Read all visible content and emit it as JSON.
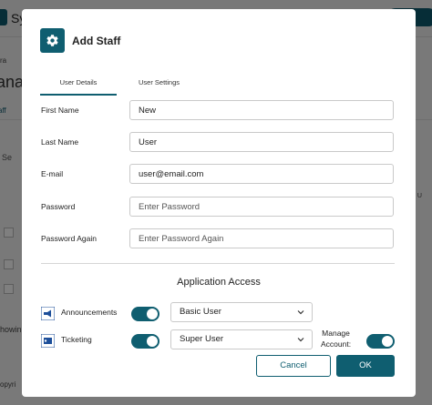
{
  "background": {
    "app_title": "Sy",
    "breadcrumb": "ra",
    "heading": "ana",
    "tab": "aff",
    "search": "Se",
    "column": "d U",
    "showing": "howin",
    "copyright": "opyri"
  },
  "modal": {
    "title": "Add Staff",
    "tabs": [
      {
        "label": "User Details",
        "active": true
      },
      {
        "label": "User Settings",
        "active": false
      }
    ],
    "fields": {
      "first_name": {
        "label": "First Name",
        "value": "New"
      },
      "last_name": {
        "label": "Last Name",
        "value": "User"
      },
      "email": {
        "label": "E-mail",
        "value": "user@email.com"
      },
      "password": {
        "label": "Password",
        "placeholder": "Enter Password"
      },
      "password_again": {
        "label": "Password Again",
        "placeholder": "Enter Password Again"
      }
    },
    "application_access": {
      "title": "Application Access",
      "apps": [
        {
          "name": "Announcements",
          "icon": "megaphone-icon",
          "enabled": true,
          "role": "Basic User"
        },
        {
          "name": "Ticketing",
          "icon": "ticketing-icon",
          "enabled": true,
          "role": "Super User"
        }
      ],
      "manage_account": {
        "label_line1": "Manage",
        "label_line2": "Account:",
        "enabled": true
      }
    },
    "buttons": {
      "cancel": "Cancel",
      "ok": "OK"
    }
  },
  "colors": {
    "accent": "#0f5e70",
    "overlay": "rgba(0,0,0,0.5)"
  }
}
